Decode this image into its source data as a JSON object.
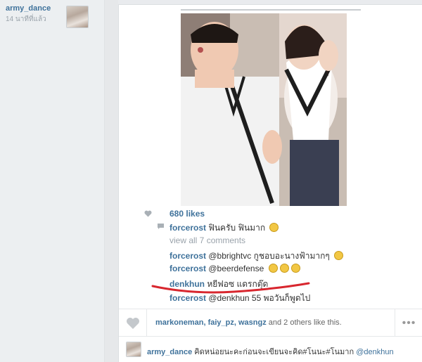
{
  "poster": {
    "username": "army_dance",
    "time_ago": "14 นาทีที่แล้ว"
  },
  "photo": {
    "likes": "680 likes",
    "comments": [
      {
        "user": "forcerost",
        "text": "ฟินครับ ฟินมาก",
        "emoji": "grin-emoji"
      },
      {
        "view_all": "view all 7 comments"
      },
      {
        "user": "forcerost",
        "text": "@bbrightvc กูชอบอะนางฟ้ามากๆ",
        "emoji": "grin-emoji"
      },
      {
        "user": "forcerost",
        "text": "@beerdefense",
        "emoji": "grin-emoji x3"
      },
      {
        "user": "denkhun",
        "text": "หยีฟอซ แดรกตุ๊ด"
      },
      {
        "user": "forcerost",
        "text": "@denkhun 55 พอวันก็พูดไป"
      }
    ]
  },
  "actions": {
    "likers_names": "markoneman, faiy_pz, wasngz",
    "likers_rest": " and 2 others like this.",
    "more_label": "•••"
  },
  "caption": {
    "user": "army_dance",
    "text": " คิดหน่อยนะคะก่อนจะเขียนจะคิด#โนนะ#โนมาก ",
    "mention": "@denkhun"
  },
  "colors": {
    "link_blue": "#3f729b",
    "muted_gray": "#9aa3ab",
    "annotation_red": "#d8262e"
  }
}
